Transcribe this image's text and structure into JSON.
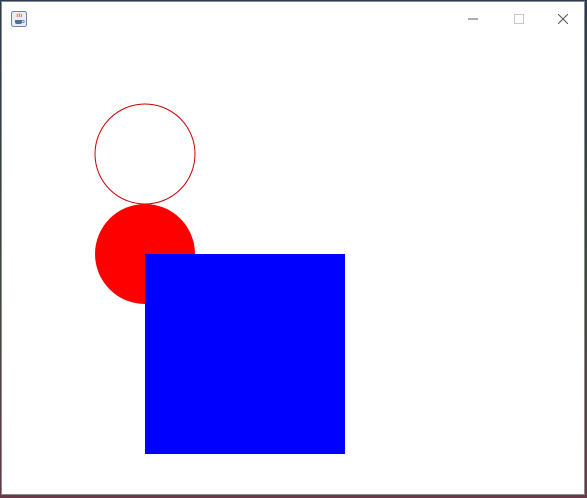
{
  "window": {
    "title": "",
    "app_icon": "java-coffee-cup-icon",
    "controls": {
      "minimize_icon": "minimize-icon",
      "maximize_icon": "maximize-icon",
      "close_icon": "close-icon"
    }
  },
  "drawing": {
    "shapes": [
      {
        "kind": "circle",
        "style": "outline",
        "color": "#cc0000"
      },
      {
        "kind": "circle",
        "style": "filled",
        "color": "#ff0000"
      },
      {
        "kind": "square",
        "style": "filled",
        "color": "#0000ff"
      }
    ]
  }
}
